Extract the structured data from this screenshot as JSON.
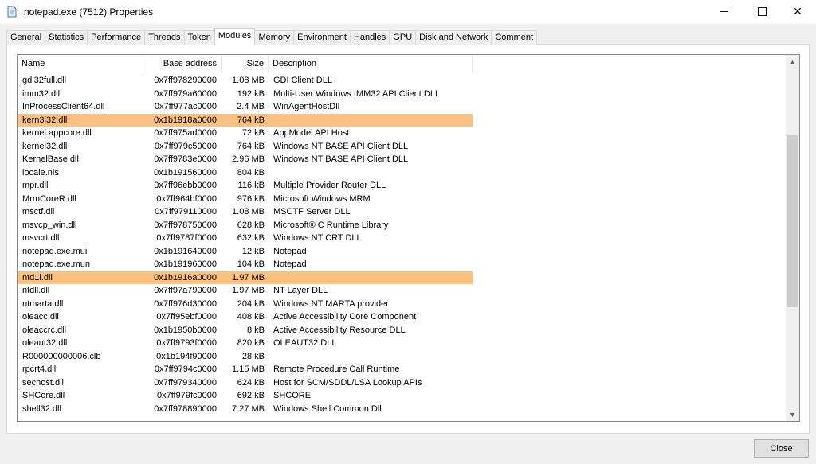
{
  "window": {
    "title": "notepad.exe (7512) Properties",
    "icon": "document-icon",
    "controls": {
      "minimize": "minimize",
      "maximize": "maximize",
      "close": "✕"
    }
  },
  "tabs": [
    {
      "label": "General"
    },
    {
      "label": "Statistics"
    },
    {
      "label": "Performance"
    },
    {
      "label": "Threads"
    },
    {
      "label": "Token"
    },
    {
      "label": "Modules",
      "active": true
    },
    {
      "label": "Memory"
    },
    {
      "label": "Environment"
    },
    {
      "label": "Handles"
    },
    {
      "label": "GPU"
    },
    {
      "label": "Disk and Network"
    },
    {
      "label": "Comment"
    }
  ],
  "columns": {
    "name": "Name",
    "base": "Base address",
    "size": "Size",
    "desc": "Description"
  },
  "highlight_color": "#fcc080",
  "modules": [
    {
      "name": "gdi32full.dll",
      "base": "0x7ff978290000",
      "size": "1.08 MB",
      "desc": "GDI Client DLL"
    },
    {
      "name": "imm32.dll",
      "base": "0x7ff979a60000",
      "size": "192 kB",
      "desc": "Multi-User Windows IMM32 API Client DLL"
    },
    {
      "name": "InProcessClient64.dll",
      "base": "0x7ff977ac0000",
      "size": "2.4 MB",
      "desc": "WinAgentHostDll"
    },
    {
      "name": "kern3l32.dll",
      "base": "0x1b1918a0000",
      "size": "764 kB",
      "desc": "",
      "highlight": true
    },
    {
      "name": "kernel.appcore.dll",
      "base": "0x7ff975ad0000",
      "size": "72 kB",
      "desc": "AppModel API Host"
    },
    {
      "name": "kernel32.dll",
      "base": "0x7ff979c50000",
      "size": "764 kB",
      "desc": "Windows NT BASE API Client DLL"
    },
    {
      "name": "KernelBase.dll",
      "base": "0x7ff9783e0000",
      "size": "2.96 MB",
      "desc": "Windows NT BASE API Client DLL"
    },
    {
      "name": "locale.nls",
      "base": "0x1b191560000",
      "size": "804 kB",
      "desc": ""
    },
    {
      "name": "mpr.dll",
      "base": "0x7ff96ebb0000",
      "size": "116 kB",
      "desc": "Multiple Provider Router DLL"
    },
    {
      "name": "MrmCoreR.dll",
      "base": "0x7ff964bf0000",
      "size": "976 kB",
      "desc": "Microsoft Windows MRM"
    },
    {
      "name": "msctf.dll",
      "base": "0x7ff979110000",
      "size": "1.08 MB",
      "desc": "MSCTF Server DLL"
    },
    {
      "name": "msvcp_win.dll",
      "base": "0x7ff978750000",
      "size": "628 kB",
      "desc": "Microsoft® C Runtime Library"
    },
    {
      "name": "msvcrt.dll",
      "base": "0x7ff9787f0000",
      "size": "632 kB",
      "desc": "Windows NT CRT DLL"
    },
    {
      "name": "notepad.exe.mui",
      "base": "0x1b191640000",
      "size": "12 kB",
      "desc": "Notepad"
    },
    {
      "name": "notepad.exe.mun",
      "base": "0x1b191960000",
      "size": "104 kB",
      "desc": "Notepad"
    },
    {
      "name": "ntd1l.dll",
      "base": "0x1b1916a0000",
      "size": "1.97 MB",
      "desc": "",
      "highlight": true
    },
    {
      "name": "ntdll.dll",
      "base": "0x7ff97a790000",
      "size": "1.97 MB",
      "desc": "NT Layer DLL"
    },
    {
      "name": "ntmarta.dll",
      "base": "0x7ff976d30000",
      "size": "204 kB",
      "desc": "Windows NT MARTA provider"
    },
    {
      "name": "oleacc.dll",
      "base": "0x7ff95ebf0000",
      "size": "408 kB",
      "desc": "Active Accessibility Core Component"
    },
    {
      "name": "oleaccrc.dll",
      "base": "0x1b1950b0000",
      "size": "8 kB",
      "desc": "Active Accessibility Resource DLL"
    },
    {
      "name": "oleaut32.dll",
      "base": "0x7ff9793f0000",
      "size": "820 kB",
      "desc": "OLEAUT32.DLL"
    },
    {
      "name": "R000000000006.clb",
      "base": "0x1b194f90000",
      "size": "28 kB",
      "desc": ""
    },
    {
      "name": "rpcrt4.dll",
      "base": "0x7ff9794c0000",
      "size": "1.15 MB",
      "desc": "Remote Procedure Call Runtime"
    },
    {
      "name": "sechost.dll",
      "base": "0x7ff979340000",
      "size": "624 kB",
      "desc": "Host for SCM/SDDL/LSA Lookup APIs"
    },
    {
      "name": "SHCore.dll",
      "base": "0x7ff979fc0000",
      "size": "692 kB",
      "desc": "SHCORE"
    },
    {
      "name": "shell32.dll",
      "base": "0x7ff978890000",
      "size": "7.27 MB",
      "desc": "Windows Shell Common Dll"
    }
  ],
  "scrollbar": {
    "up": "▲",
    "down": "▼"
  },
  "footer": {
    "close_label": "Close"
  }
}
